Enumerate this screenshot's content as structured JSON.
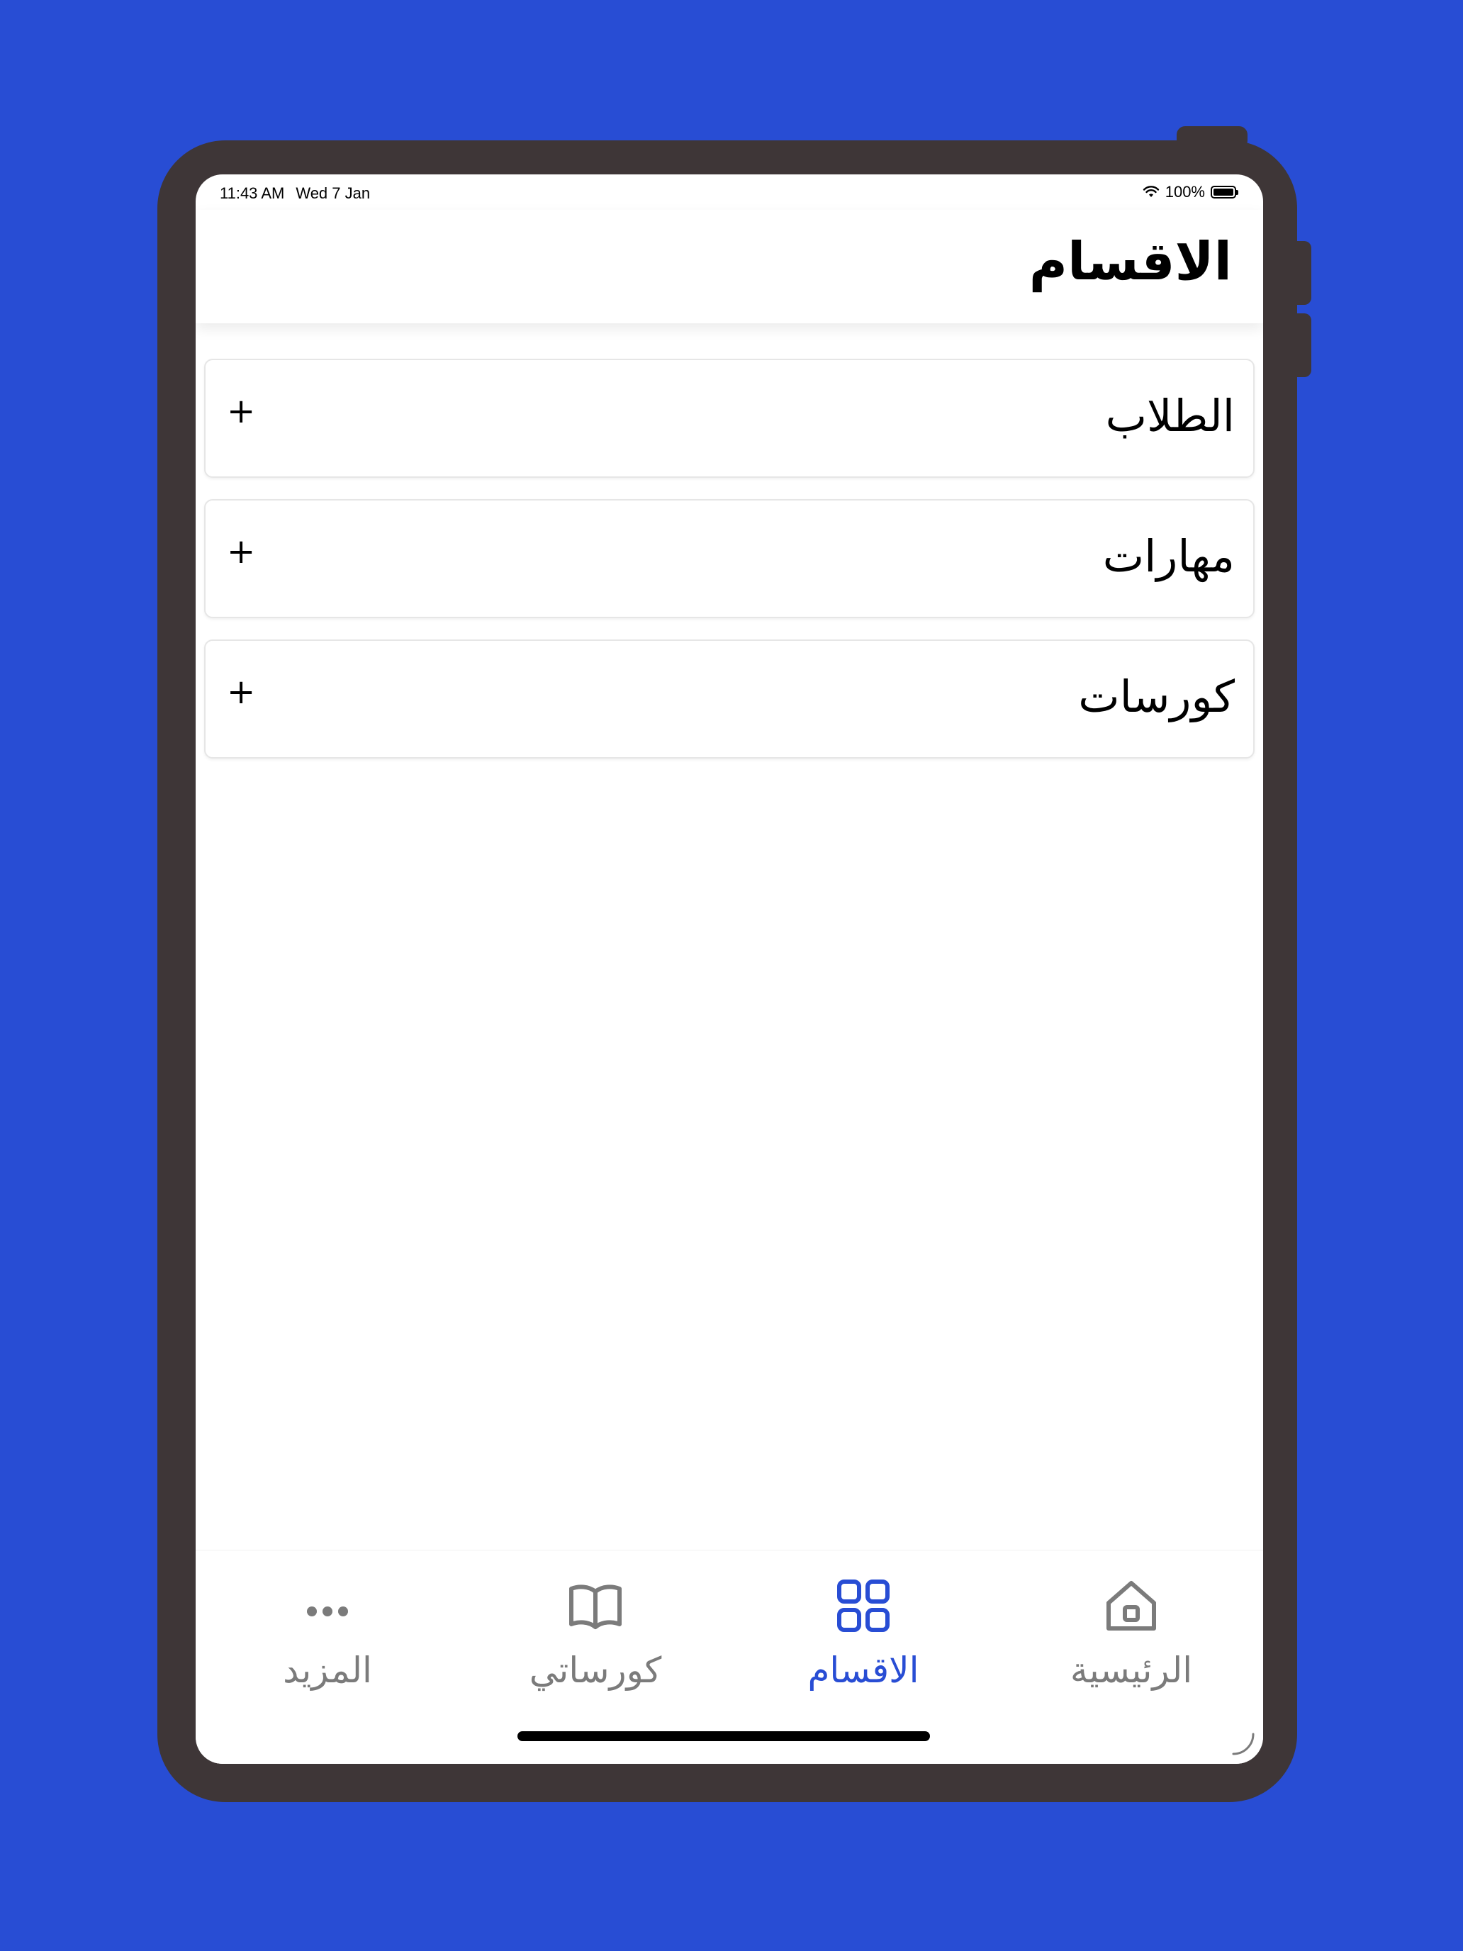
{
  "status_bar": {
    "time": "11:43 AM",
    "date": "Wed 7 Jan",
    "battery": "100%"
  },
  "header": {
    "title": "الاقسام"
  },
  "sections": [
    {
      "label": "الطلاب",
      "expand": "+"
    },
    {
      "label": "مهارات",
      "expand": "+"
    },
    {
      "label": "كورسات",
      "expand": "+"
    }
  ],
  "tab_bar": {
    "active_tab": "الاقسام",
    "tabs": [
      {
        "label": "الرئيسية",
        "icon": "home-icon"
      },
      {
        "label": "الاقسام",
        "icon": "grid-icon"
      },
      {
        "label": "كورساتي",
        "icon": "book-icon"
      },
      {
        "label": "المزيد",
        "icon": "more-dots-icon"
      }
    ]
  },
  "colors": {
    "background": "#284dd4",
    "device_frame": "#3e3637",
    "accent": "#284dd4",
    "inactive_tab": "#7b7b7b"
  }
}
